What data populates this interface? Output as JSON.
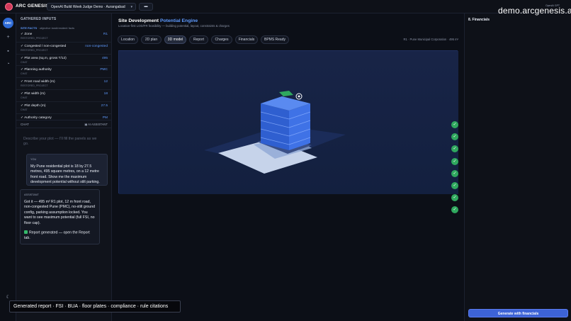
{
  "app": {
    "brand": "ARC GENESIS",
    "project_selector": "OpenAI Build Week Judge Demo · Aurangabad",
    "watermark": "demo.arcgenesis.ai",
    "openai_tag": "OpenAI GPT",
    "caption": "Generated report · FSI · BUA · floor plates · compliance · rule citations"
  },
  "rail": {
    "badge": "ARC"
  },
  "left_panel": {
    "header": "GATHERED INPUTS",
    "site_facts_label": "SITE FACTS",
    "site_facts_hint": "· objective land/resident facts",
    "facts": [
      {
        "label": "✓ Zone",
        "value": "R1",
        "source": "RESTORED_PROJECT"
      },
      {
        "label": "✓ Congested / non-congested",
        "value": "non-congested",
        "source": "RESTORED_PROJECT"
      },
      {
        "label": "✓ Plot area (sq.m, gross T/12)",
        "value": "495",
        "source": "CHAT"
      },
      {
        "label": "✓ Planning authority",
        "value": "PMC",
        "source": "CHAT"
      },
      {
        "label": "✓ Front road width (m)",
        "value": "12",
        "source": "RESTORED_PROJECT"
      },
      {
        "label": "✓ Plot width (m)",
        "value": "18",
        "source": "CHAT"
      },
      {
        "label": "✓ Plot depth (m)",
        "value": "27.5",
        "source": "CHAT"
      },
      {
        "label": "✓ Authority category",
        "value": "PM",
        "source": "CHAT"
      }
    ],
    "chat_title": "CHAT",
    "chat_mode": "AI ASSISTANT",
    "chat_placeholder": "Describe your plot — I'll fill the panels as we go.",
    "user_msg": {
      "who": "YOU",
      "text": "My Pune residential plot is 18 by 27.5 metres, 495 square metres, on a 12 metre front road. Show me the maximum development potential without stilt parking."
    },
    "ai_msg": {
      "who": "ASSISTANT",
      "text": "Got it — 495 m² R1 plot, 12 m front road, non-congested Pune (PMC), no-stilt ground config, parking assumption locked. You want to see maximum potential (full FSI, no floor cap).",
      "status": "Report generated — open the Report tab."
    }
  },
  "main": {
    "title_prefix": "Site Development",
    "title_accent": "Potential Engine",
    "subtitle": "Location-first LOD/FR feasibility — building potential, layout, constraints & charges",
    "tabs": [
      {
        "label": "Location",
        "active": false
      },
      {
        "label": "2D plan",
        "active": false
      },
      {
        "label": "3D model",
        "active": true
      },
      {
        "label": "Report",
        "active": false
      },
      {
        "label": "Charges",
        "active": false
      },
      {
        "label": "Financials",
        "active": false
      },
      {
        "label": "BPMS Ready",
        "active": false
      }
    ],
    "zone_info": "R1 · Pune Municipal Corporation · 495 m²",
    "checks_count": 8
  },
  "right_panel": {
    "title": "8. Financials",
    "generate_button": "Generate with financials"
  },
  "colors": {
    "accent": "#5f9bff",
    "viewport_bg": "#17244a",
    "building": "#2f5fd0",
    "check_green": "#2fa85e",
    "primary_button": "#3d63d6"
  }
}
